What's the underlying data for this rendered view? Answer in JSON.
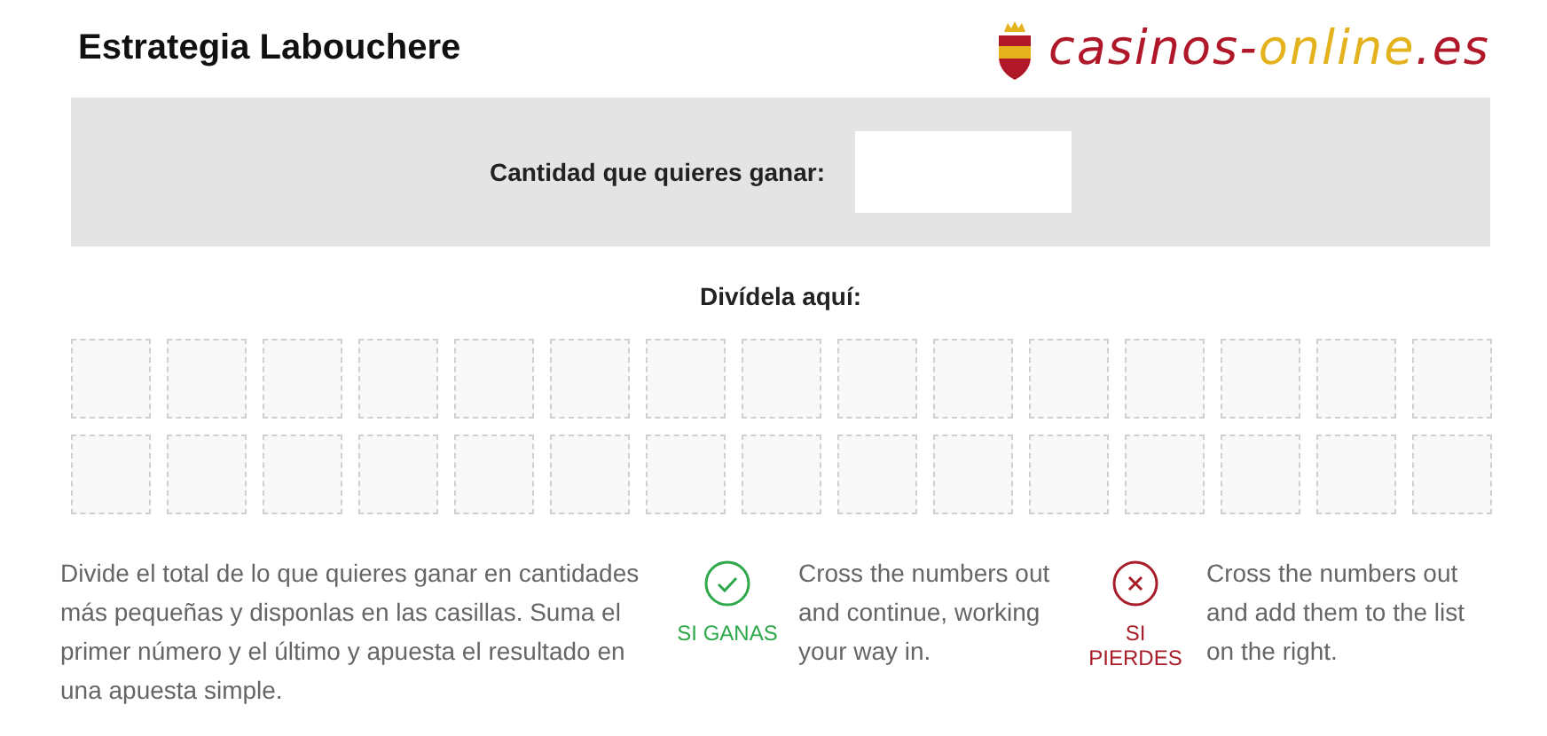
{
  "title": "Estrategia Labouchere",
  "logo": {
    "parts": [
      {
        "text": "casinos-",
        "color": "#b0182a"
      },
      {
        "text": "online",
        "color": "#e3b21c"
      },
      {
        "text": ".es",
        "color": "#b0182a"
      }
    ]
  },
  "goal": {
    "label": "Cantidad que quieres ganar:"
  },
  "split": {
    "label": "Divídela aquí:"
  },
  "instructions": "Divide el total de lo que quieres ganar en cantidades más pequeñas y disponlas en las casillas. Suma el primer número y el último y apuesta el resultado en una apuesta simple.",
  "outcomes": [
    {
      "kind": "win",
      "label": "SI GANAS",
      "text": "Cross the numbers out and continue, working your way in."
    },
    {
      "kind": "lose",
      "label": "SI PIERDES",
      "text": "Cross the numbers out and add them to the list on the right."
    }
  ]
}
